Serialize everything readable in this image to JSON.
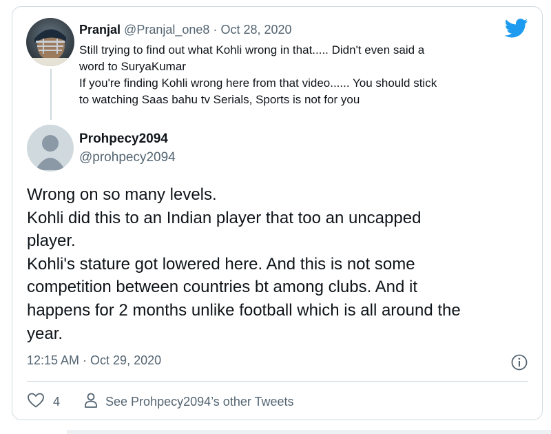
{
  "original_tweet": {
    "display_name": "Pranjal",
    "handle": "@Pranjal_one8",
    "separator": "·",
    "date": "Oct 28, 2020",
    "lines": [
      "Still trying to find out what Kohli wrong in that..... Didn't even said a",
      "word to SuryaKumar",
      "If you're finding Kohli wrong here from that video...... You should stick",
      "to watching Saas bahu tv Serials, Sports is not for you"
    ]
  },
  "reply": {
    "display_name": "Prohpecy2094",
    "handle": "@prohpecy2094",
    "lines": [
      "Wrong on so many levels.",
      "Kohli did this to an Indian player that too an uncapped",
      "player.",
      "Kohli's stature got lowered here. And this is not some",
      "competition between countries bt among clubs. And it",
      "happens for 2 months unlike football which is all around the",
      "year."
    ],
    "timestamp": "12:15 AM · Oct 29, 2020"
  },
  "actions": {
    "like_count": "4",
    "see_other_label": "See Prohpecy2094’s other Tweets"
  },
  "icons": {
    "logo": "twitter-bird-icon",
    "info": "info-icon",
    "like": "heart-icon",
    "profile": "person-icon"
  },
  "colors": {
    "brand": "#1d9bf0",
    "text": "#0f1419",
    "muted": "#536471",
    "border": "#cfd9de"
  }
}
